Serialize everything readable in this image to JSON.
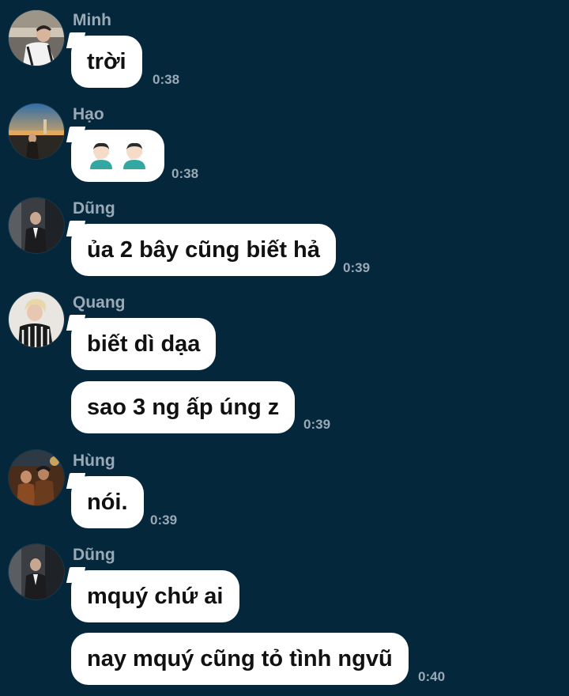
{
  "messages": [
    {
      "sender": "Minh",
      "avatar": "avatar-minh",
      "bubbles": [
        "trời"
      ],
      "time": "0:38"
    },
    {
      "sender": "Hạo",
      "avatar": "avatar-hao",
      "bubbles": [
        "🤦🏻‍♂️🤦🏻‍♂️"
      ],
      "time": "0:38"
    },
    {
      "sender": "Dũng",
      "avatar": "avatar-dung",
      "bubbles": [
        "ủa 2 bây cũng biết hả"
      ],
      "time": "0:39"
    },
    {
      "sender": "Quang",
      "avatar": "avatar-quang",
      "bubbles": [
        "biết dì dạa",
        "sao 3 ng ấp úng z"
      ],
      "time": "0:39"
    },
    {
      "sender": "Hùng",
      "avatar": "avatar-hung",
      "bubbles": [
        "nói."
      ],
      "time": "0:39"
    },
    {
      "sender": "Dũng",
      "avatar": "avatar-dung",
      "bubbles": [
        "mquý chứ ai",
        "nay mquý cũng tỏ tình ngvũ"
      ],
      "time": "0:40"
    }
  ],
  "emoji_icon": "man-facepalming-icon",
  "colors": {
    "background": "#04273c",
    "bubble": "#ffffff",
    "meta_text": "#9aa9b5"
  }
}
